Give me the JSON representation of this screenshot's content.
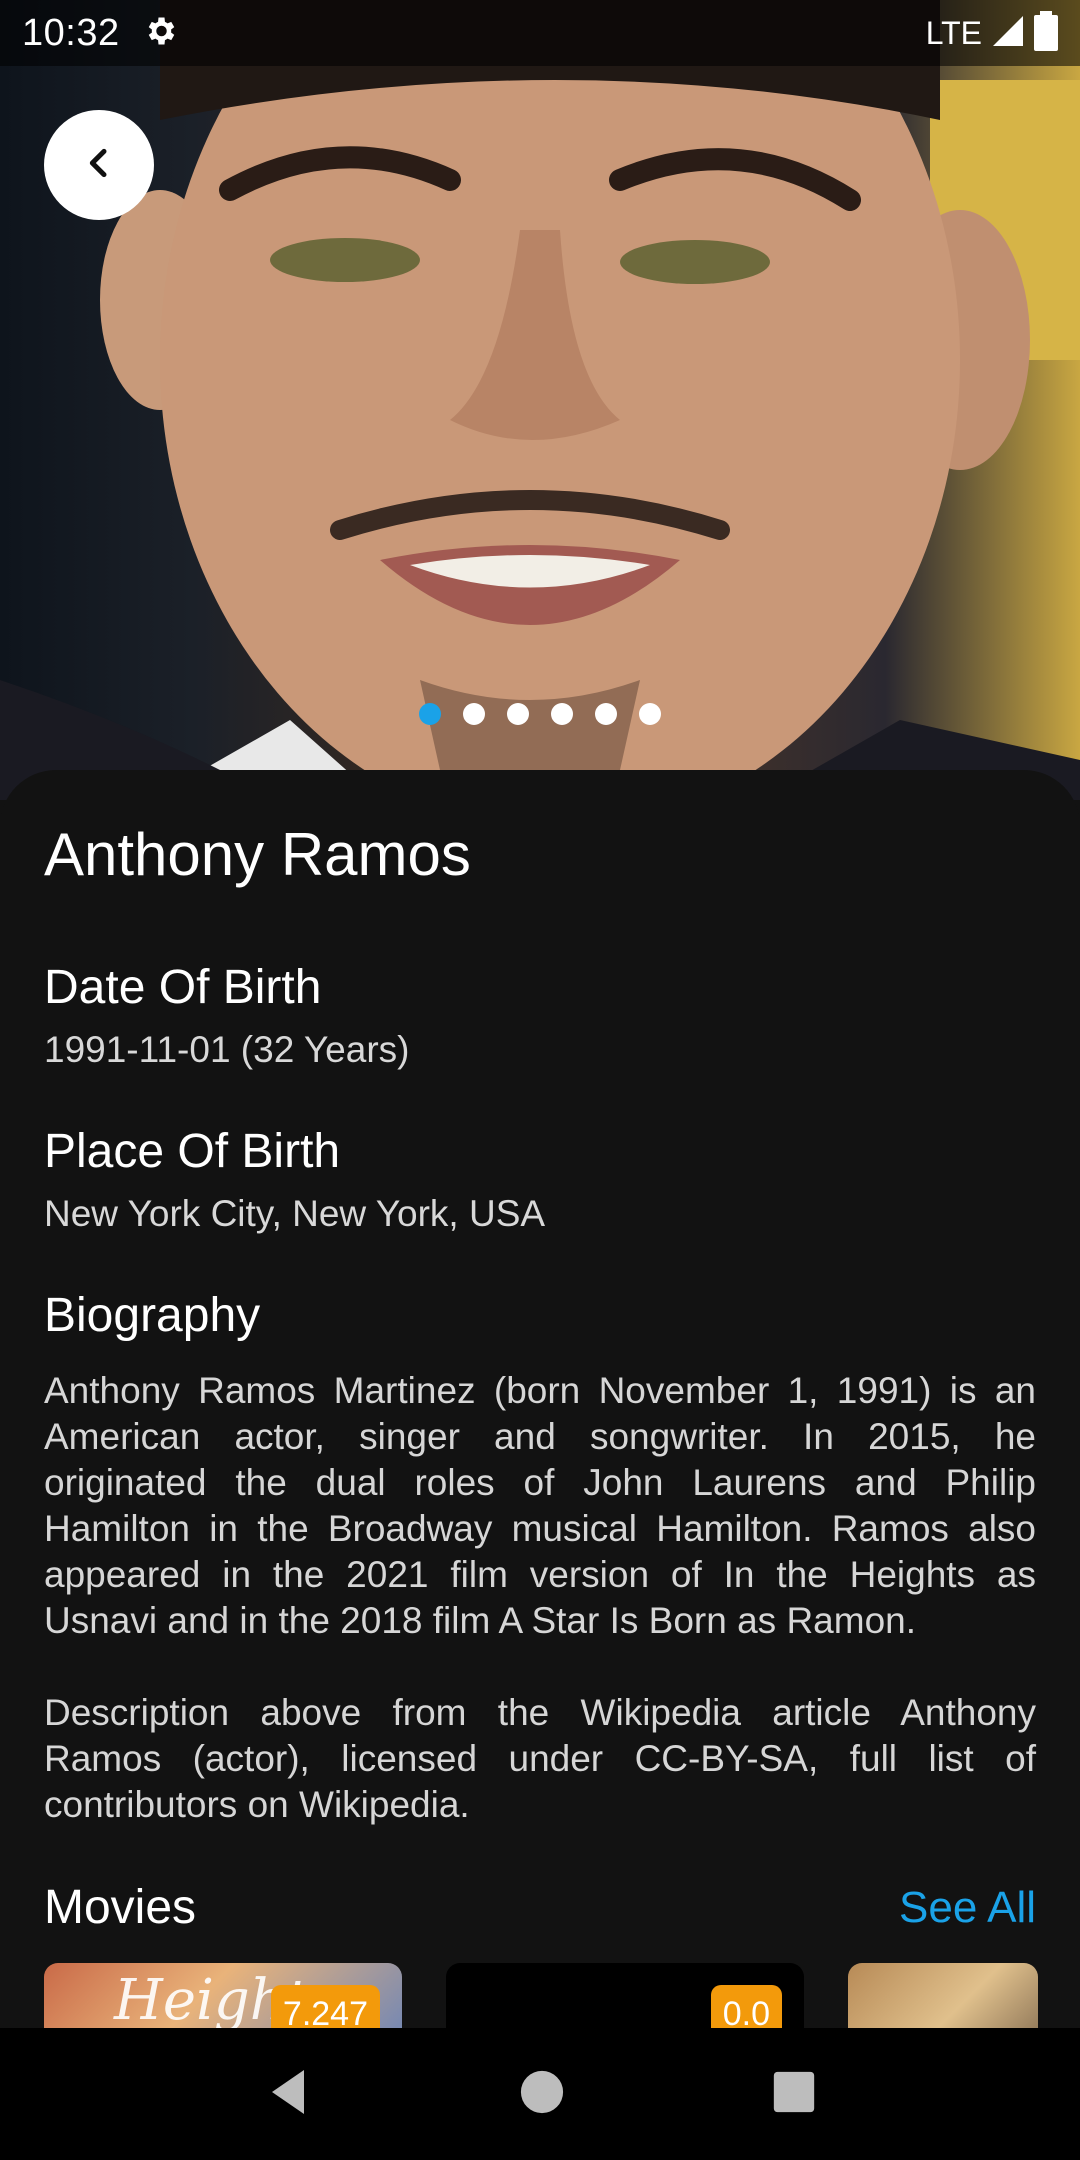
{
  "status_bar": {
    "time": "10:32",
    "network": "LTE",
    "icons": [
      "gear-icon",
      "signal-icon",
      "battery-icon"
    ]
  },
  "carousel": {
    "dot_count": 6,
    "active_index": 0,
    "active_color": "#1aa2e8"
  },
  "person": {
    "name": "Anthony Ramos",
    "date_of_birth_label": "Date Of Birth",
    "date_of_birth_value": "1991-11-01 (32 Years)",
    "place_of_birth_label": "Place Of Birth",
    "place_of_birth_value": "New York City, New York, USA",
    "biography_label": "Biography",
    "biography_p1": "Anthony Ramos Martinez (born November 1, 1991) is an American actor, singer and songwriter. In 2015, he originated the dual roles of John Laurens and Philip Hamilton in the Broadway musical Hamilton. Ramos also appeared in the 2021 film version of In the Heights as Usnavi and in the 2018 film A Star Is Born as Ramon.",
    "biography_p2": "Description above from the Wikipedia article Anthony Ramos (actor), licensed under CC-BY-SA, full list of contributors on Wikipedia."
  },
  "movies": {
    "title": "Movies",
    "see_all": "See All",
    "items": [
      {
        "poster_text": "Heights",
        "rating": "7.247"
      },
      {
        "poster_text": "",
        "rating": "0.0"
      },
      {
        "poster_text": "",
        "rating": ""
      }
    ]
  },
  "colors": {
    "background": "#121212",
    "accent": "#1aa2e8",
    "rating_badge": "#f39a0b"
  }
}
